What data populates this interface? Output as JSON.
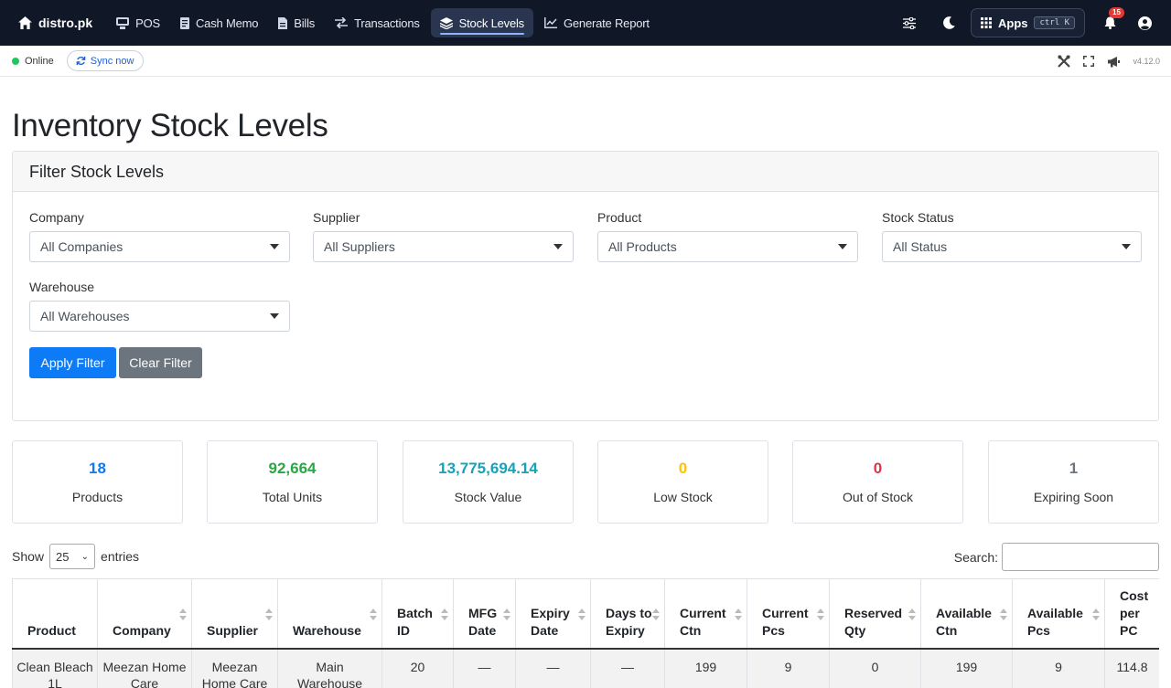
{
  "nav": {
    "brand": "distro.pk",
    "items": [
      {
        "label": "POS",
        "icon": "pos-icon"
      },
      {
        "label": "Cash Memo",
        "icon": "cash-memo-icon"
      },
      {
        "label": "Bills",
        "icon": "bills-icon"
      },
      {
        "label": "Transactions",
        "icon": "transactions-icon"
      },
      {
        "label": "Stock Levels",
        "icon": "layers-icon",
        "active": true
      },
      {
        "label": "Generate Report",
        "icon": "chart-icon"
      }
    ],
    "apps_label": "Apps",
    "apps_shortcut": "ctrl K",
    "notification_count": "15"
  },
  "status": {
    "online_label": "Online",
    "sync_label": "Sync now",
    "version": "v4.12.0"
  },
  "page": {
    "title": "Inventory Stock Levels"
  },
  "filter": {
    "header": "Filter Stock Levels",
    "company": {
      "label": "Company",
      "value": "All Companies"
    },
    "supplier": {
      "label": "Supplier",
      "value": "All Suppliers"
    },
    "product": {
      "label": "Product",
      "value": "All Products"
    },
    "stock_status": {
      "label": "Stock Status",
      "value": "All Status"
    },
    "warehouse": {
      "label": "Warehouse",
      "value": "All Warehouses"
    },
    "apply_label": "Apply Filter",
    "clear_label": "Clear Filter"
  },
  "stats": [
    {
      "value": "18",
      "label": "Products",
      "color": "#0d7bf5"
    },
    {
      "value": "92,664",
      "label": "Total Units",
      "color": "#28a745"
    },
    {
      "value": "13,775,694.14",
      "label": "Stock Value",
      "color": "#17a2b8"
    },
    {
      "value": "0",
      "label": "Low Stock",
      "color": "#ffc107"
    },
    {
      "value": "0",
      "label": "Out of Stock",
      "color": "#dc3545"
    },
    {
      "value": "1",
      "label": "Expiring Soon",
      "color": "#6c757d"
    }
  ],
  "table": {
    "show_label": "Show",
    "entries_value": "25",
    "entries_label": "entries",
    "search_label": "Search:",
    "headers": [
      "Product",
      "Company",
      "Supplier",
      "Warehouse",
      "Batch ID",
      "MFG Date",
      "Expiry Date",
      "Days to Expiry",
      "Current Ctn",
      "Current Pcs",
      "Reserved Qty",
      "Available Ctn",
      "Available Pcs",
      "Cost per PC"
    ],
    "rows": [
      [
        "Clean Bleach 1L",
        "Meezan Home Care",
        "Meezan Home Care",
        "Main Warehouse",
        "20",
        "—",
        "—",
        "—",
        "199",
        "9",
        "0",
        "199",
        "9",
        "114.8"
      ]
    ]
  }
}
